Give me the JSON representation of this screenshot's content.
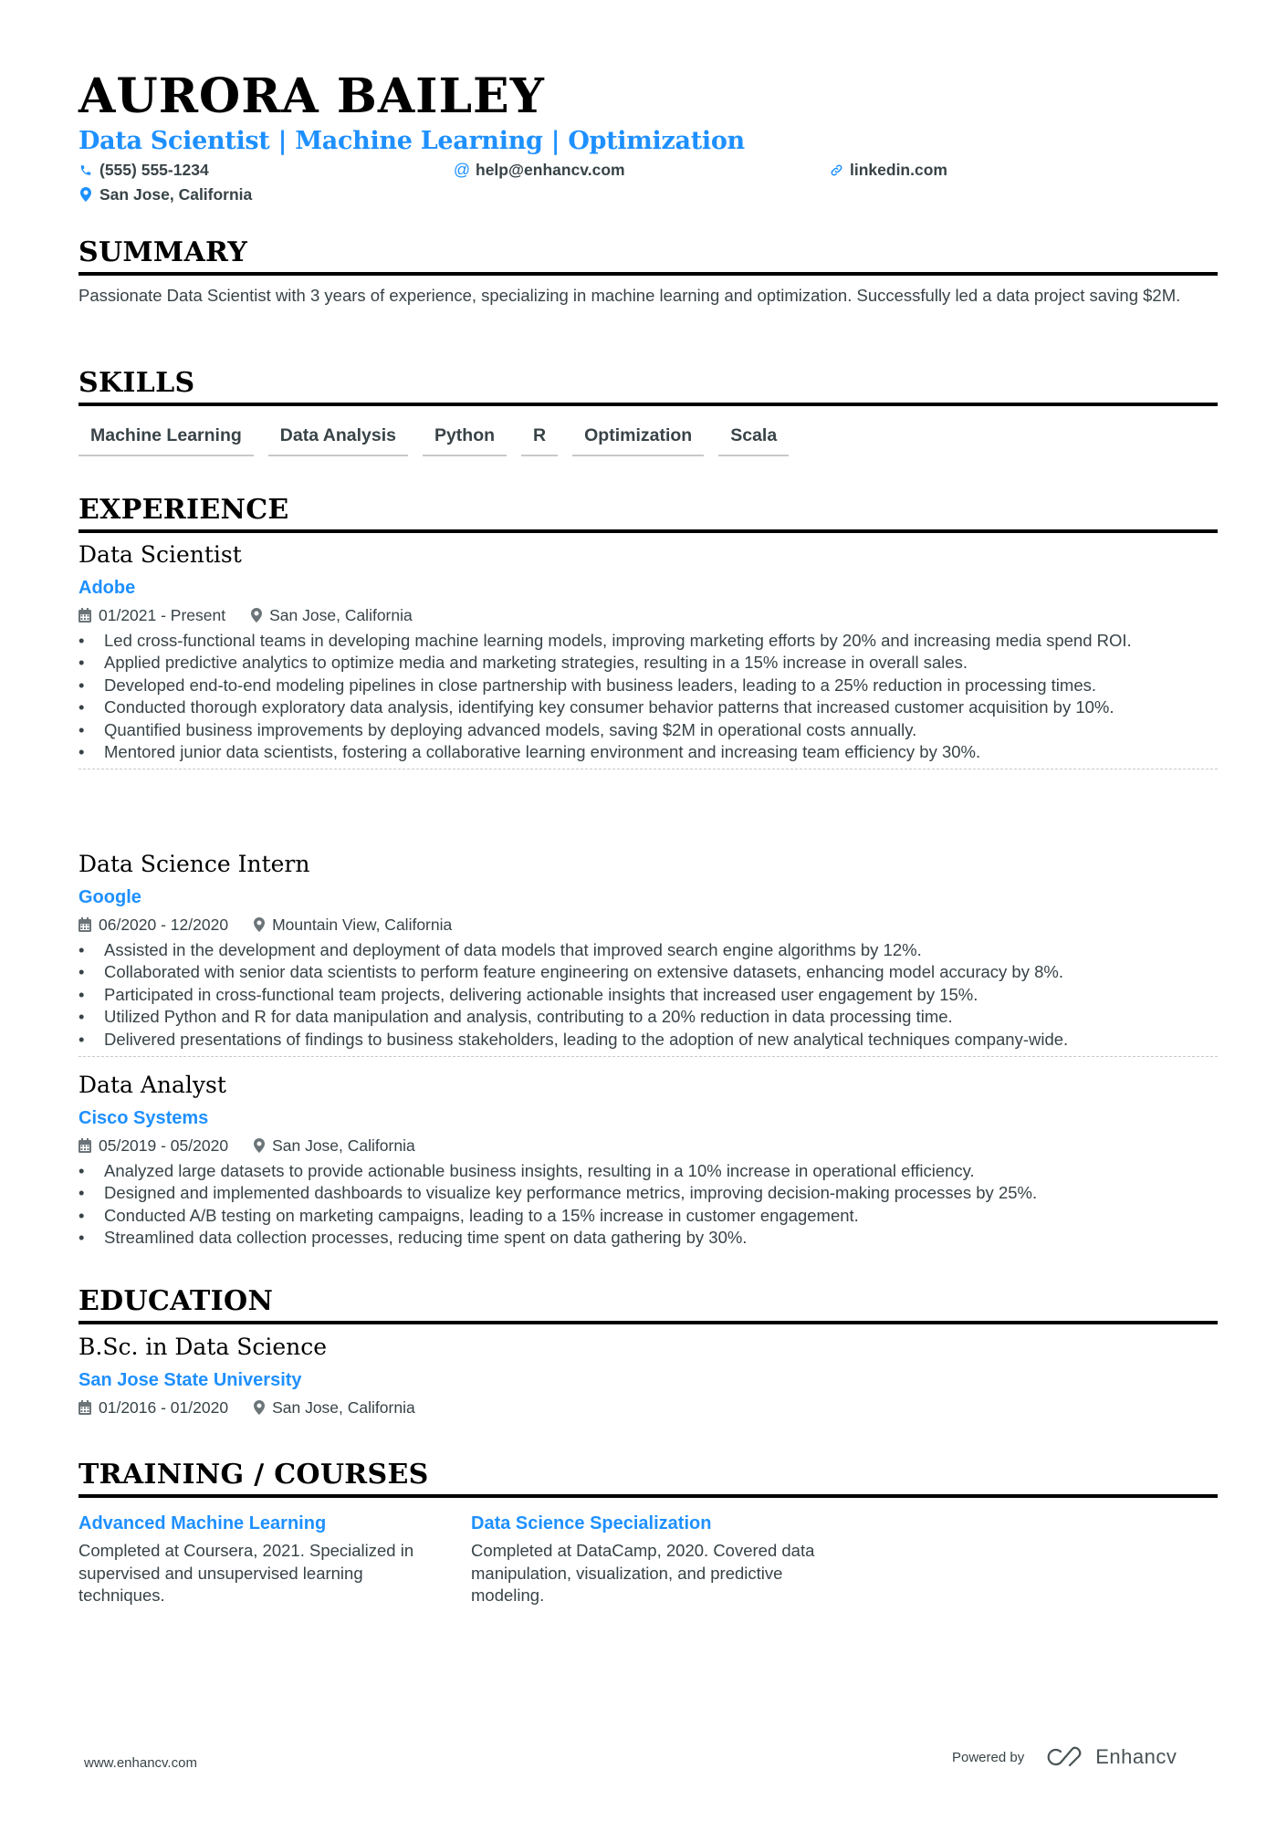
{
  "header": {
    "name": "AURORA BAILEY",
    "headline": "Data Scientist | Machine Learning | Optimization",
    "contacts": {
      "phone": "(555) 555-1234",
      "email": "help@enhancv.com",
      "linkedin": "linkedin.com",
      "location": "San Jose, California"
    }
  },
  "summary": {
    "title": "SUMMARY",
    "text": "Passionate Data Scientist with 3 years of experience, specializing in machine learning and optimization. Successfully led a data project saving $2M."
  },
  "skills": {
    "title": "SKILLS",
    "items": [
      "Machine Learning",
      "Data Analysis",
      "Python",
      "R",
      "Optimization",
      "Scala"
    ]
  },
  "experience": {
    "title": "EXPERIENCE",
    "jobs": [
      {
        "title": "Data Scientist",
        "company": "Adobe",
        "dates": "01/2021 - Present",
        "location": "San Jose, California",
        "bullets": [
          "Led cross-functional teams in developing machine learning models, improving marketing efforts by 20% and increasing media spend ROI.",
          "Applied predictive analytics to optimize media and marketing strategies, resulting in a 15% increase in overall sales.",
          "Developed end-to-end modeling pipelines in close partnership with business leaders, leading to a 25% reduction in processing times.",
          "Conducted thorough exploratory data analysis, identifying key consumer behavior patterns that increased customer acquisition by 10%.",
          "Quantified business improvements by deploying advanced models, saving $2M in operational costs annually.",
          "Mentored junior data scientists, fostering a collaborative learning environment and increasing team efficiency by 30%."
        ]
      },
      {
        "title": "Data Science Intern",
        "company": "Google",
        "dates": "06/2020 - 12/2020",
        "location": "Mountain View, California",
        "bullets": [
          "Assisted in the development and deployment of data models that improved search engine algorithms by 12%.",
          "Collaborated with senior data scientists to perform feature engineering on extensive datasets, enhancing model accuracy by 8%.",
          "Participated in cross-functional team projects, delivering actionable insights that increased user engagement by 15%.",
          "Utilized Python and R for data manipulation and analysis, contributing to a 20% reduction in data processing time.",
          "Delivered presentations of findings to business stakeholders, leading to the adoption of new analytical techniques company-wide."
        ]
      },
      {
        "title": "Data Analyst",
        "company": "Cisco Systems",
        "dates": "05/2019 - 05/2020",
        "location": "San Jose, California",
        "bullets": [
          "Analyzed large datasets to provide actionable business insights, resulting in a 10% increase in operational efficiency.",
          "Designed and implemented dashboards to visualize key performance metrics, improving decision-making processes by 25%.",
          "Conducted A/B testing on marketing campaigns, leading to a 15% increase in customer engagement.",
          "Streamlined data collection processes, reducing time spent on data gathering by 30%."
        ]
      }
    ]
  },
  "education": {
    "title": "EDUCATION",
    "degree": "B.Sc. in Data Science",
    "school": "San Jose State University",
    "dates": "01/2016 - 01/2020",
    "location": "San Jose, California"
  },
  "training": {
    "title": "TRAINING / COURSES",
    "courses": [
      {
        "title": "Advanced Machine Learning",
        "description": "Completed at Coursera, 2021. Specialized in supervised and unsupervised learning techniques."
      },
      {
        "title": "Data Science Specialization",
        "description": "Completed at DataCamp, 2020. Covered data manipulation, visualization, and predictive modeling."
      }
    ]
  },
  "footer": {
    "website": "www.enhancv.com",
    "powered_by": "Powered by",
    "brand": "Enhancv"
  },
  "colors": {
    "accent": "#1e90ff",
    "text": "#384347",
    "heading": "#000000"
  }
}
